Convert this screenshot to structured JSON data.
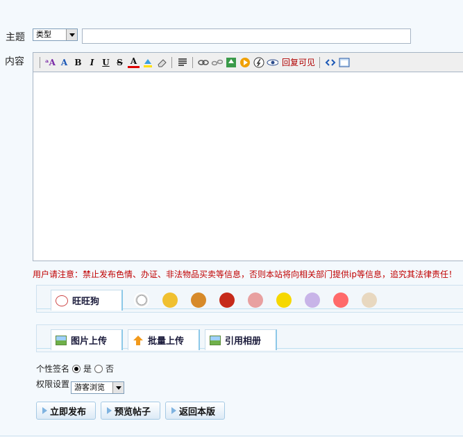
{
  "form": {
    "subject_label": "主题",
    "content_label": "内容",
    "type_select": "类型",
    "subject_value": ""
  },
  "toolbar": {
    "reply_visible_label": "回复可见",
    "bold": "B",
    "italic": "I",
    "underline": "U",
    "strike": "S",
    "font_color": "A"
  },
  "notice": "用户请注意：禁止发布色情、办证、非法物品买卖等信息，否则本站将向相关部门提供ip等信息，追究其法律责任！",
  "smiley_tabs": {
    "active_label": "旺旺狗"
  },
  "upload_tabs": {
    "image_upload": "图片上传",
    "batch_upload": "批量上传",
    "album": "引用相册"
  },
  "signature": {
    "label": "个性签名",
    "yes": "是",
    "no": "否",
    "selected": "是"
  },
  "permission": {
    "label": "权限设置",
    "selected": "游客浏览"
  },
  "buttons": {
    "publish": "立即发布",
    "preview": "预览帖子",
    "back": "返回本版"
  },
  "colors": {
    "notice": "#c00000",
    "tab_border": "#8cc8e8",
    "page_bg": "#f4f9fd"
  }
}
